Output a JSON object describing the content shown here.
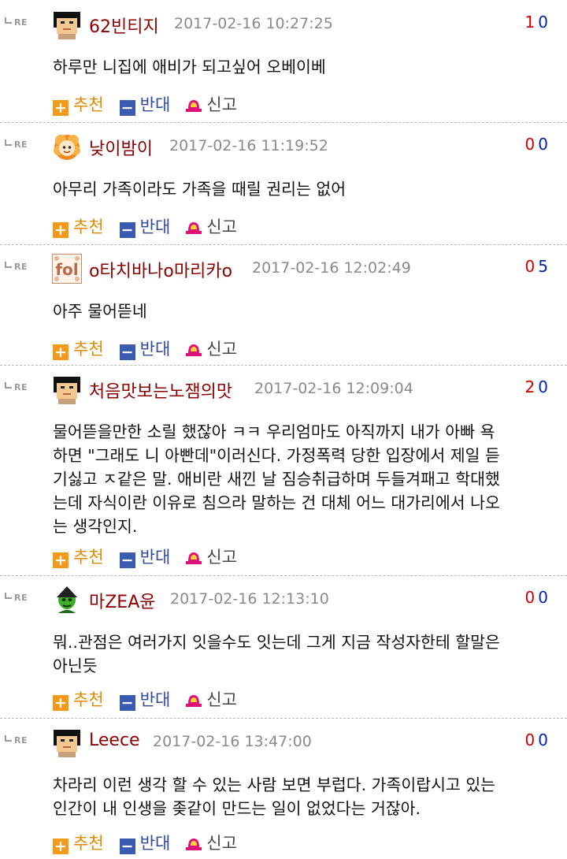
{
  "labels": {
    "re": "RE",
    "recommend": "추천",
    "oppose": "반대",
    "report": "신고"
  },
  "colors": {
    "nickname": "#8b0000",
    "recommend": "#f49a1a",
    "oppose": "#3b5bb0",
    "up_votes": "#d40000",
    "down_votes": "#0022aa"
  },
  "comments": [
    {
      "avatar": "pixel-face-avatar",
      "nickname": "62빈티지",
      "date": "2017-02-16 10:27:25",
      "up": "1",
      "down": "0",
      "lines": [
        "하루만 니집에 애비가 되고싶어 오베이베"
      ]
    },
    {
      "avatar": "orange-flower-avatar",
      "nickname": "낮이밤이",
      "date": "2017-02-16 11:19:52",
      "up": "0",
      "down": "0",
      "lines": [
        "아무리 가족이라도 가족을 때릴 권리는 없어"
      ]
    },
    {
      "avatar": "fol-pattern-avatar",
      "nickname": "o타치바나o마리카o",
      "date": "2017-02-16 12:02:49",
      "up": "0",
      "down": "5",
      "lines": [
        "아주 물어뜯네"
      ]
    },
    {
      "avatar": "pixel-face-avatar",
      "nickname": "처음맛보는노잼의맛",
      "date": "2017-02-16 12:09:04",
      "up": "2",
      "down": "0",
      "lines": [
        "물어뜯을만한 소릴 했잖아 ㅋㅋ 우리엄마도 아직까지 내가 아빠 욕",
        "하면 \"그래도 니 아빤데\"이러신다. 가정폭력 당한 입장에서 제일 듣",
        "기싫고 ㅈ같은 말. 애비란 새낀 날 짐승취급하며 두들겨패고 학대했",
        "는데 자식이란 이유로 침으라 말하는 건 대체 어느 대가리에서 나오",
        "는 생각인지."
      ]
    },
    {
      "avatar": "green-goblin-avatar",
      "nickname": "마ZEA윤",
      "date": "2017-02-16 12:13:10",
      "up": "0",
      "down": "0",
      "lines": [
        "뭐..관점은 여러가지 잇을수도 잇는데 그게 지금 작성자한테 할말은",
        "아닌듯"
      ]
    },
    {
      "avatar": "pixel-face-avatar",
      "nickname": "Leece",
      "date": "2017-02-16 13:47:00",
      "up": "0",
      "down": "0",
      "lines": [
        "차라리 이런 생각 할 수 있는 사람 보면 부럽다. 가족이랍시고 있는",
        "인간이 내 인생을 좆같이 만드는 일이 없었다는 거잖아."
      ]
    }
  ]
}
